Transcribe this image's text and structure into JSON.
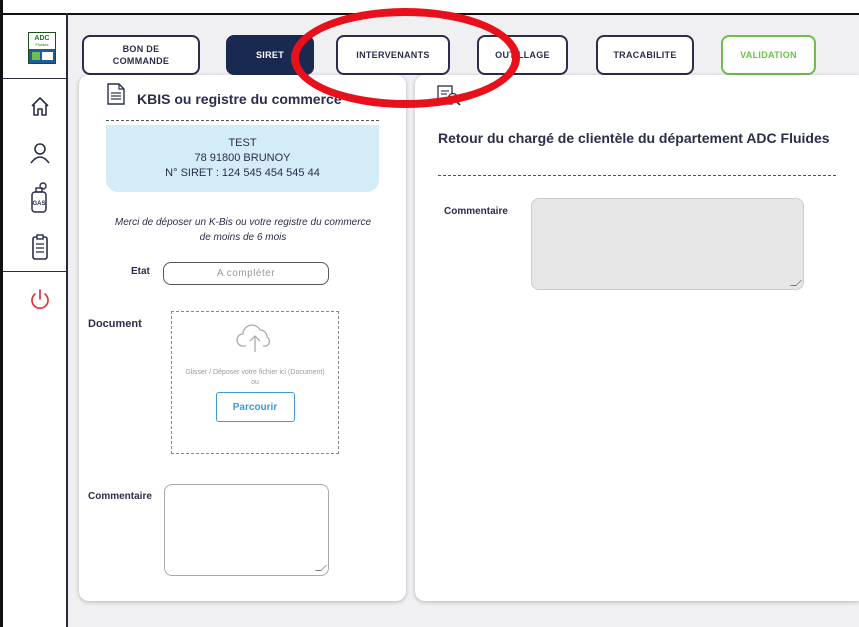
{
  "sidebar": {
    "logo_text_top": "ADC",
    "logo_text_sub": "Fluides",
    "icons": [
      "home-icon",
      "user-icon",
      "gas-bottle-icon",
      "clipboard-icon",
      "power-icon"
    ],
    "gas_label": "GAS"
  },
  "tabs": [
    {
      "label": "BON DE COMMANDE",
      "line1": "BON DE",
      "line2": "COMMANDE",
      "state": "default"
    },
    {
      "label": "SIRET",
      "state": "active"
    },
    {
      "label": "INTERVENANTS",
      "state": "default"
    },
    {
      "label": "OUTILLAGE",
      "visible_text": "OU   ILLAGE",
      "state": "default"
    },
    {
      "label": "TRACABILITE",
      "state": "default"
    },
    {
      "label": "VALIDATION",
      "state": "green"
    }
  ],
  "left_panel": {
    "title": "KBIS ou registre du commerce",
    "company_name": "TEST",
    "address": "78 91800 BRUNOY",
    "siret_line": "N° SIRET : 124 545 454 545 44",
    "hint": "Merci de déposer un K-Bis ou votre registre du commerce de moins de 6 mois",
    "etat_label": "Etat",
    "etat_value": "A compléter",
    "document_label": "Document",
    "drop_text": "Glisser / Déposer votre fichier ici (Document)",
    "drop_or": "ou",
    "browse_label": "Parcourir",
    "comment_label": "Commentaire"
  },
  "right_panel": {
    "title": "Retour du chargé de clientèle du département ADC Fluides",
    "comment_label": "Commentaire"
  },
  "colors": {
    "navy": "#1a2950",
    "text": "#2b2d4a",
    "green": "#6cc04a",
    "light_blue": "#d3ecf8",
    "link_blue": "#3a9bd6",
    "power_red": "#e0333d",
    "annotation_red": "#e8101b"
  }
}
